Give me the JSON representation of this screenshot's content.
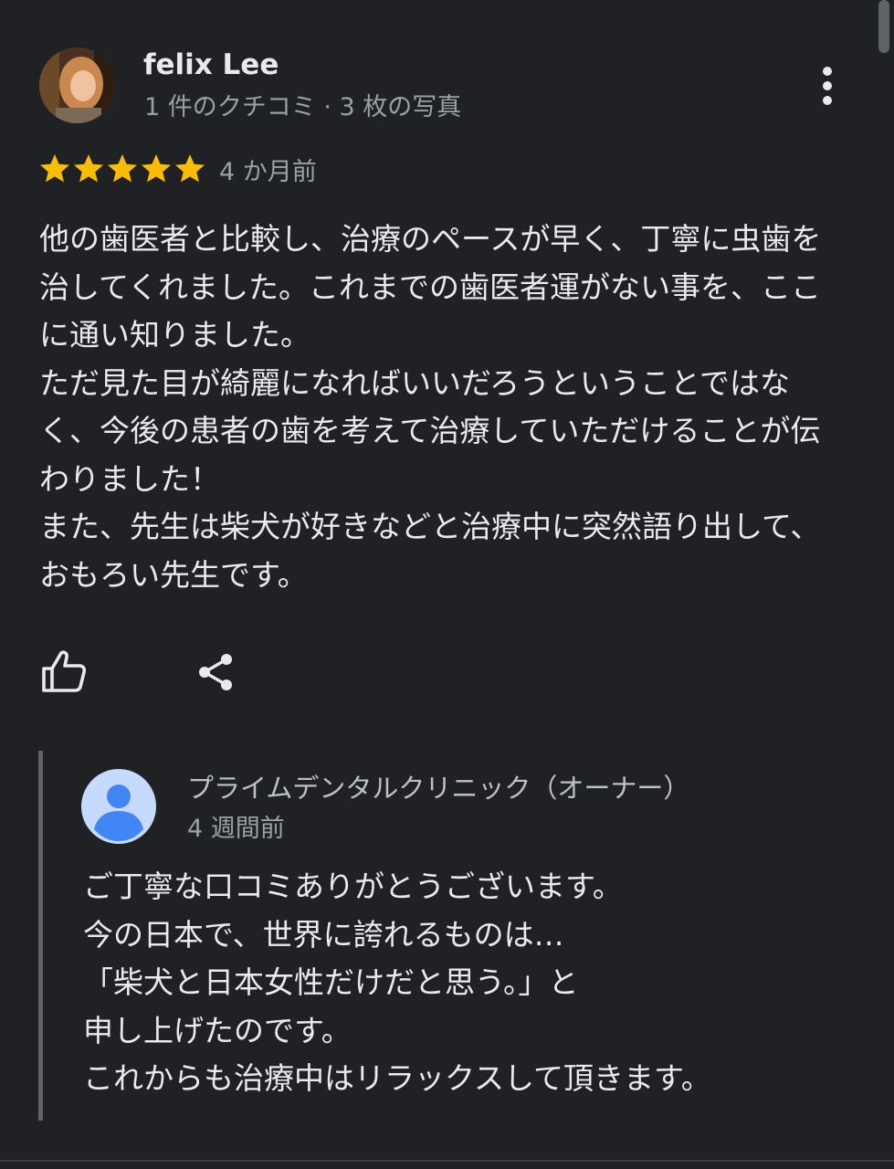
{
  "review": {
    "user_name": "felix Lee",
    "user_meta": "1 件のクチコミ · 3 枚の写真",
    "rating": 5,
    "time": "4 か月前",
    "text": "他の歯医者と比較し、治療のペースが早く、丁寧に虫歯を治してくれました。これまでの歯医者運がない事を、ここに通い知りました。\nただ見た目が綺麗になればいいだろうということではなく、今後の患者の歯を考えて治療していただけることが伝わりました！\nまた、先生は柴犬が好きなどと治療中に突然語り出して、おもろい先生です。"
  },
  "actions": {
    "like_icon": "thumb-up-icon",
    "share_icon": "share-icon",
    "more_icon": "more-vertical-icon"
  },
  "owner_reply": {
    "name": "プライムデンタルクリニック（オーナー）",
    "time": "4 週間前",
    "text": "ご丁寧な口コミありがとうございます。\n今の日本で、世界に誇れるものは…\n「柴犬と日本女性だけだと思う。」と\n申し上げたのです。\nこれからも治療中はリラックスして頂きます。"
  },
  "colors": {
    "background": "#202124",
    "star": "#fbbc04",
    "owner_avatar": "#7baaf7"
  }
}
